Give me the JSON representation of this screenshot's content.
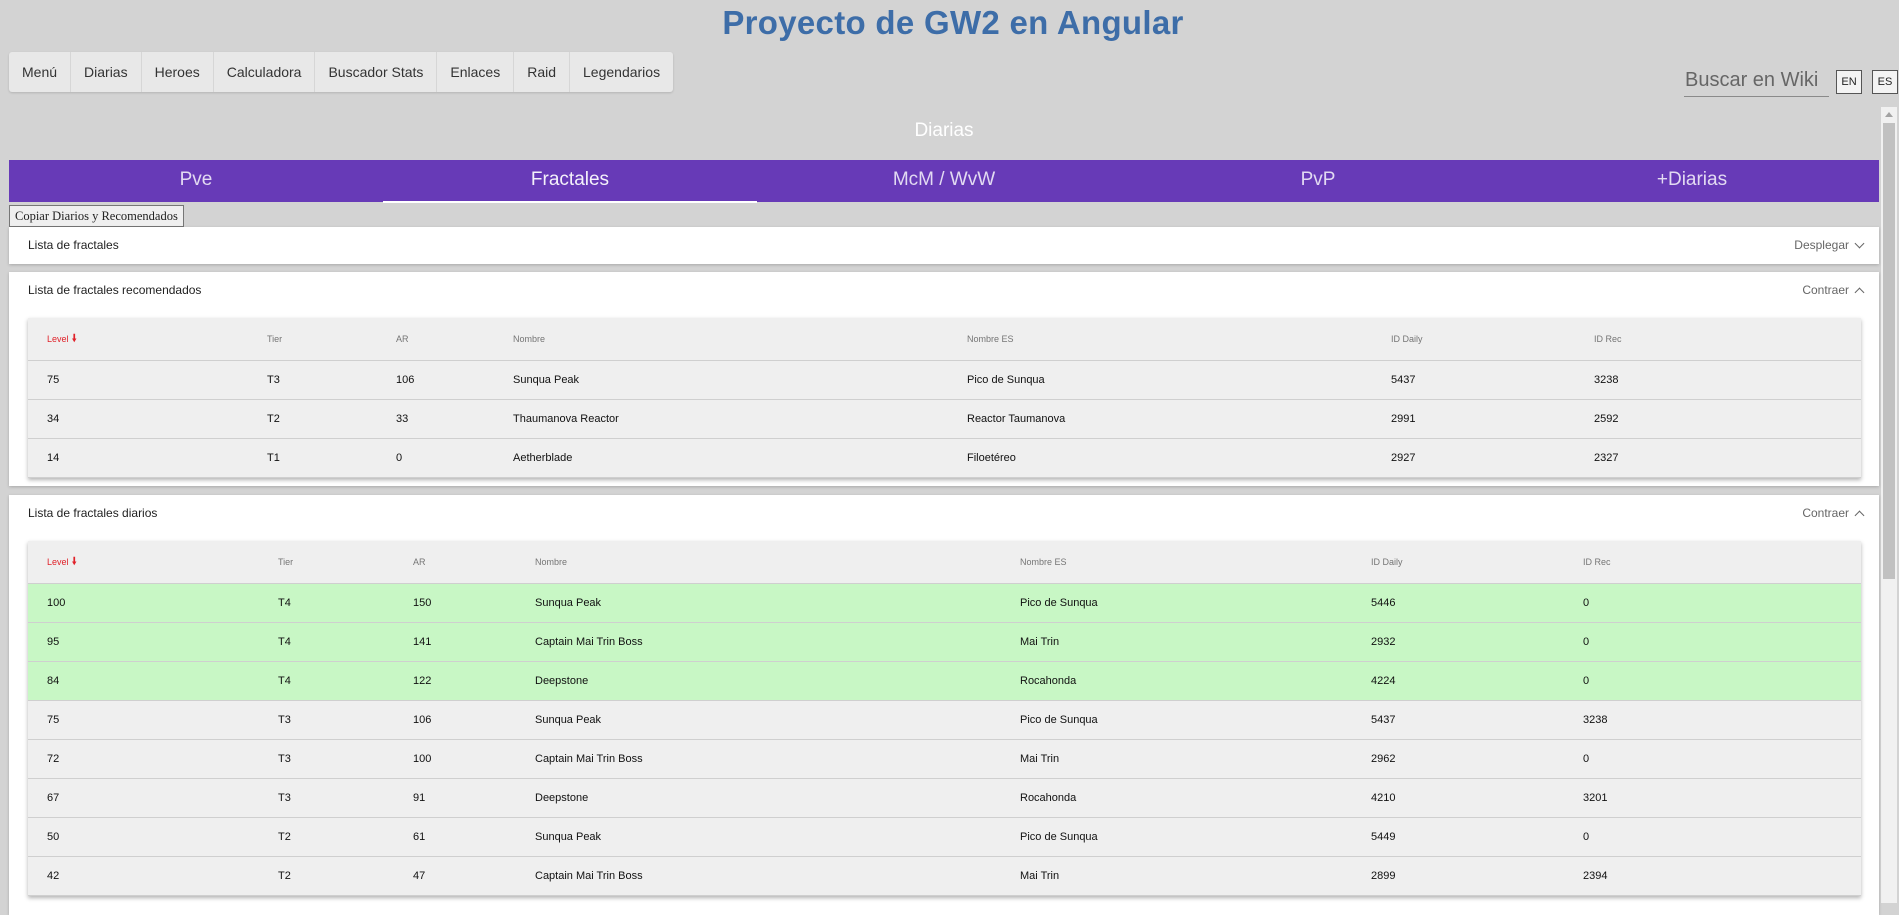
{
  "site_title": "Proyecto de GW2 en Angular",
  "nav": [
    "Menú",
    "Diarias",
    "Heroes",
    "Calculadora",
    "Buscador Stats",
    "Enlaces",
    "Raid",
    "Legendarios"
  ],
  "search": {
    "placeholder": "Buscar en Wiki"
  },
  "lang": {
    "en": "EN",
    "es": "ES"
  },
  "section_title": "Diarias",
  "tabs": [
    {
      "label": "Pve",
      "active": false
    },
    {
      "label": "Fractales",
      "active": true
    },
    {
      "label": "McM / WvW",
      "active": false
    },
    {
      "label": "PvP",
      "active": false
    },
    {
      "label": "+Diarias",
      "active": false
    }
  ],
  "copy_button": "Copiar Diarios y Recomendados",
  "columns": [
    "Level",
    "Tier",
    "AR",
    "Nombre",
    "Nombre ES",
    "ID Daily",
    "ID Rec"
  ],
  "sort_icon": "arrow-down-icon",
  "accent_color": "#673ab7",
  "highlight_color": "#c8f7c5",
  "panels": {
    "list": {
      "title": "Lista de fractales",
      "action": "Desplegar"
    },
    "recommended": {
      "title": "Lista de fractales recomendados",
      "action": "Contraer"
    },
    "daily": {
      "title": "Lista de fractales diarios",
      "action": "Contraer"
    }
  },
  "recommended_rows": [
    [
      "75",
      "T3",
      "106",
      "Sunqua Peak",
      "Pico de Sunqua",
      "5437",
      "3238"
    ],
    [
      "34",
      "T2",
      "33",
      "Thaumanova Reactor",
      "Reactor Taumanova",
      "2991",
      "2592"
    ],
    [
      "14",
      "T1",
      "0",
      "Aetherblade",
      "Filoetéreo",
      "2927",
      "2327"
    ]
  ],
  "daily_rows": [
    [
      "100",
      "T4",
      "150",
      "Sunqua Peak",
      "Pico de Sunqua",
      "5446",
      "0"
    ],
    [
      "95",
      "T4",
      "141",
      "Captain Mai Trin Boss",
      "Mai Trin",
      "2932",
      "0"
    ],
    [
      "84",
      "T4",
      "122",
      "Deepstone",
      "Rocahonda",
      "4224",
      "0"
    ],
    [
      "75",
      "T3",
      "106",
      "Sunqua Peak",
      "Pico de Sunqua",
      "5437",
      "3238"
    ],
    [
      "72",
      "T3",
      "100",
      "Captain Mai Trin Boss",
      "Mai Trin",
      "2962",
      "0"
    ],
    [
      "67",
      "T3",
      "91",
      "Deepstone",
      "Rocahonda",
      "4210",
      "3201"
    ],
    [
      "50",
      "T2",
      "61",
      "Sunqua Peak",
      "Pico de Sunqua",
      "5449",
      "0"
    ],
    [
      "42",
      "T2",
      "47",
      "Captain Mai Trin Boss",
      "Mai Trin",
      "2899",
      "2394"
    ]
  ],
  "daily_highlighted_count": 3
}
